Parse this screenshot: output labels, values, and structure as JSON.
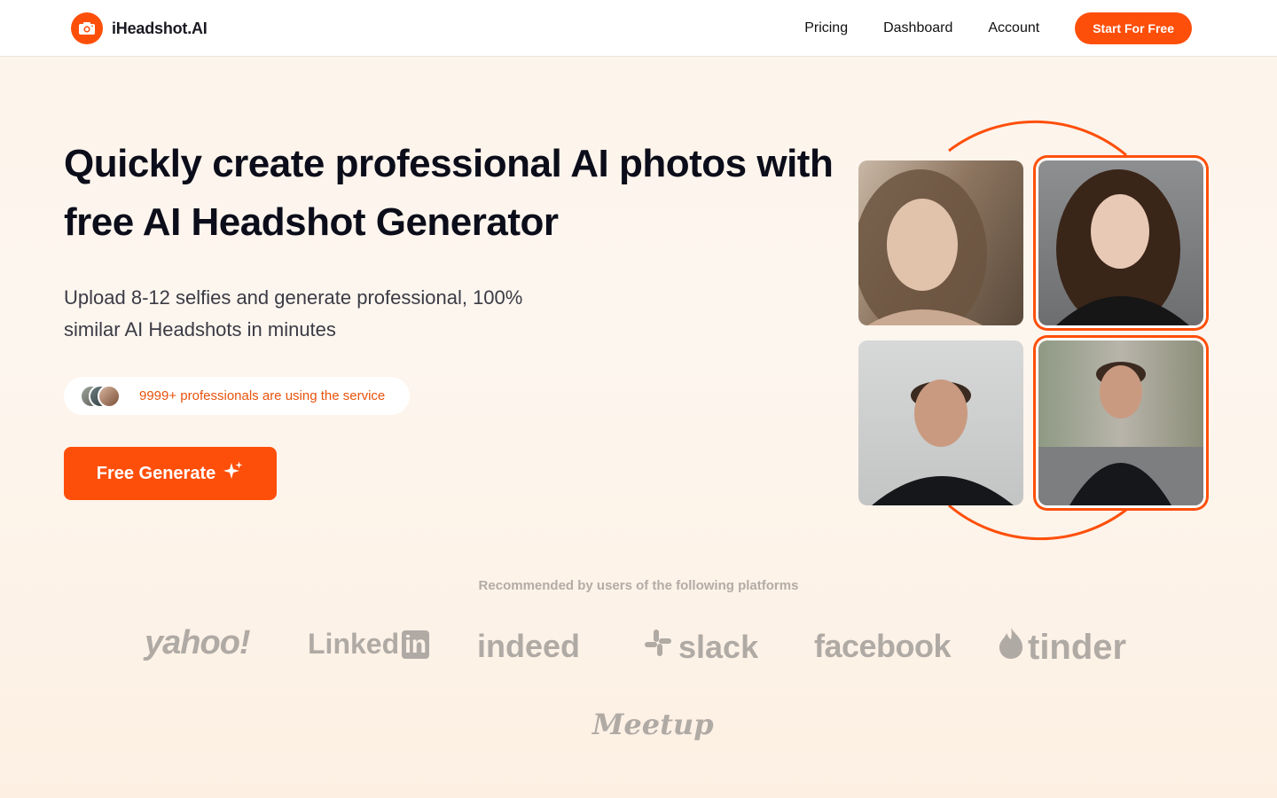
{
  "header": {
    "logo_text": "iHeadshot.AI",
    "nav": [
      "Pricing",
      "Dashboard",
      "Account"
    ],
    "cta": "Start For Free"
  },
  "hero": {
    "title": "Quickly create professional AI photos with free AI Headshot Generator",
    "subtitle": "Upload 8-12 selfies and generate professional, 100% similar AI Headshots in minutes",
    "users_text": "9999+ professionals are using the service",
    "button": "Free Generate"
  },
  "platforms": {
    "heading": "Recommended by users of the following platforms",
    "names": [
      "yahoo!",
      "Linked",
      "in",
      "indeed",
      "slack",
      "facebook",
      "tinder",
      "Meetup"
    ]
  },
  "colors": {
    "accent": "#fe4f0a",
    "brand_gray": "#b0aaa5"
  }
}
